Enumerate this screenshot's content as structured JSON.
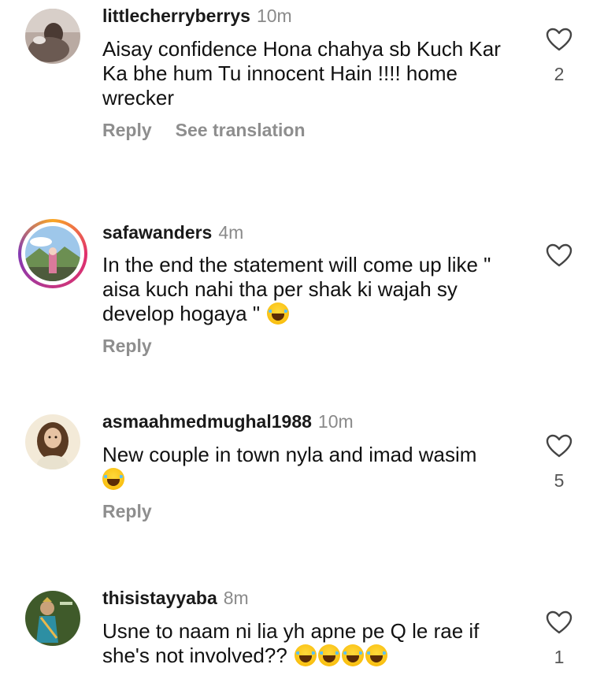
{
  "comments": [
    {
      "username": "littlecherryberrys",
      "time": "10m",
      "text": "Aisay confidence Hona chahya sb Kuch Kar Ka bhe hum Tu innocent Hain !!!! home wrecker",
      "reply_label": "Reply",
      "translate_label": "See translation",
      "like_count": "2"
    },
    {
      "username": "safawanders",
      "time": "4m",
      "text": "In the end the statement will come up like \" aisa kuch nahi tha per shak ki wajah sy develop hogaya \"",
      "reply_label": "Reply",
      "like_count": ""
    },
    {
      "username": "asmaahmedmughal1988",
      "time": "10m",
      "text": "New couple in town nyla and imad wasim",
      "reply_label": "Reply",
      "like_count": "5"
    },
    {
      "username": "thisistayyaba",
      "time": "8m",
      "text": "Usne to naam ni lia yh apne pe Q le rae if she's not involved??",
      "like_count": "1"
    }
  ],
  "icons": {
    "like": "heart-outline-icon",
    "emoji": "face-with-tears-of-joy-emoji"
  },
  "colors": {
    "text": "#111111",
    "muted": "#8e8e8e",
    "story_ring_start": "#f9a825",
    "story_ring_end": "#833ab4"
  }
}
